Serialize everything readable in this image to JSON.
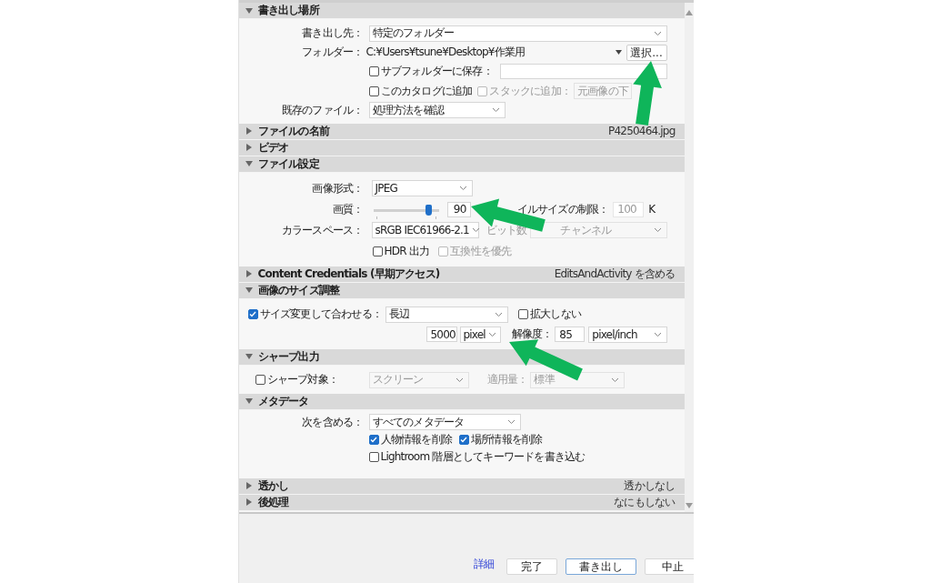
{
  "sections": [
    {
      "title": "書き出し場所",
      "expanded": true,
      "rows": [
        {
          "items": [
            {
              "kind": "label",
              "text": "書き出し先：",
              "disabled": false
            },
            {
              "kind": "select",
              "value": "特定のフォルダー",
              "disabled": false
            }
          ]
        },
        {
          "items": [
            {
              "kind": "label",
              "text": "フォルダー：",
              "disabled": false
            },
            {
              "kind": "text",
              "text": "C:¥Users¥tsune¥Desktop¥作業用"
            },
            {
              "kind": "caret"
            },
            {
              "kind": "button",
              "label": "選択..."
            }
          ]
        },
        {
          "items": [
            {
              "kind": "checkbox",
              "label": "サブフォルダーに保存：",
              "checked": false,
              "disabled": false
            },
            {
              "kind": "input",
              "disabled": false
            }
          ]
        },
        {
          "items": [
            {
              "kind": "checkbox",
              "label": "このカタログに追加",
              "checked": false,
              "disabled": false
            },
            {
              "kind": "checkbox",
              "label": "スタックに追加：",
              "checked": false,
              "disabled": true
            },
            {
              "kind": "partial-select",
              "value": "元画像の下",
              "disabled": true
            }
          ]
        },
        {
          "items": [
            {
              "kind": "label",
              "text": "既存のファイル：",
              "disabled": false
            },
            {
              "kind": "select",
              "value": "処理方法を確認",
              "disabled": false
            }
          ]
        }
      ]
    },
    {
      "title": "ファイルの名前",
      "expanded": false,
      "summary": "P4250464.jpg"
    },
    {
      "title": "ビデオ",
      "expanded": false
    },
    {
      "title": "ファイル設定",
      "expanded": true,
      "rows": [
        {
          "items": [
            {
              "kind": "label",
              "text": "画像形式：",
              "disabled": false
            },
            {
              "kind": "select",
              "value": "JPEG",
              "disabled": false
            }
          ]
        },
        {
          "items": [
            {
              "kind": "label",
              "text": "画質：",
              "disabled": false
            },
            {
              "kind": "slider",
              "level": 0.85
            },
            {
              "kind": "input",
              "value": "90",
              "disabled": false
            },
            {
              "kind": "label",
              "text": "イルサイズの制限：",
              "disabled": false
            },
            {
              "kind": "input",
              "value": "100",
              "disabled": true
            },
            {
              "kind": "unit",
              "text": "K"
            }
          ]
        },
        {
          "items": [
            {
              "kind": "label",
              "text": "カラースペース：",
              "disabled": false
            },
            {
              "kind": "select",
              "value": "sRGB IEC61966-2.1",
              "disabled": false
            },
            {
              "kind": "label",
              "text": "ビット数",
              "disabled": true
            },
            {
              "kind": "select",
              "value": "チャンネル",
              "disabled": true
            }
          ]
        },
        {
          "items": [
            {
              "kind": "checkbox",
              "label": "HDR 出力",
              "checked": false,
              "disabled": false
            },
            {
              "kind": "checkbox",
              "label": "互換性を優先",
              "checked": false,
              "disabled": true
            }
          ]
        }
      ]
    },
    {
      "title": "Content Credentials (早期アクセス)",
      "expanded": false,
      "summary": "EditsAndActivity を含める"
    },
    {
      "title": "画像のサイズ調整",
      "expanded": true,
      "rows": [
        {
          "items": [
            {
              "kind": "checkbox",
              "label": "サイズ変更して合わせる：",
              "checked": true,
              "disabled": false
            },
            {
              "kind": "select",
              "value": "長辺",
              "disabled": false
            },
            {
              "kind": "checkbox",
              "label": "拡大しない",
              "checked": false,
              "disabled": false
            }
          ]
        },
        {
          "items": [
            {
              "kind": "input",
              "value": "5000",
              "disabled": false
            },
            {
              "kind": "select",
              "value": "pixel",
              "disabled": false
            },
            {
              "kind": "label",
              "text": "解像度：",
              "disabled": false
            },
            {
              "kind": "input",
              "value": "85",
              "disabled": false
            },
            {
              "kind": "select",
              "value": "pixel/inch",
              "disabled": false
            }
          ]
        }
      ]
    },
    {
      "title": "シャープ出力",
      "expanded": true,
      "rows": [
        {
          "items": [
            {
              "kind": "checkbox",
              "label": "シャープ対象：",
              "checked": false,
              "disabled": false
            },
            {
              "kind": "select",
              "value": "スクリーン",
              "disabled": true
            },
            {
              "kind": "label",
              "text": "適用量：",
              "disabled": true
            },
            {
              "kind": "select",
              "value": "標準",
              "disabled": true
            }
          ]
        }
      ]
    },
    {
      "title": "メタデータ",
      "expanded": true,
      "rows": [
        {
          "items": [
            {
              "kind": "label",
              "text": "次を含める：",
              "disabled": false
            },
            {
              "kind": "select",
              "value": "すべてのメタデータ",
              "disabled": false
            }
          ]
        },
        {
          "items": [
            {
              "kind": "checkbox",
              "label": "人物情報を削除",
              "checked": true,
              "disabled": false
            },
            {
              "kind": "checkbox",
              "label": "場所情報を削除",
              "checked": true,
              "disabled": false
            }
          ]
        },
        {
          "items": [
            {
              "kind": "checkbox",
              "label": "Lightroom 階層としてキーワードを書き込む",
              "checked": false,
              "disabled": false
            }
          ]
        }
      ]
    },
    {
      "title": "透かし",
      "expanded": false,
      "summary": "透かしなし"
    },
    {
      "title": "後処理",
      "expanded": false,
      "summary": "なにもしない"
    }
  ],
  "footer": {
    "link": "詳細",
    "buttons": [
      {
        "label": "完了",
        "primary": false
      },
      {
        "label": "書き出し",
        "primary": true
      },
      {
        "label": "中止",
        "primary": false
      }
    ]
  }
}
